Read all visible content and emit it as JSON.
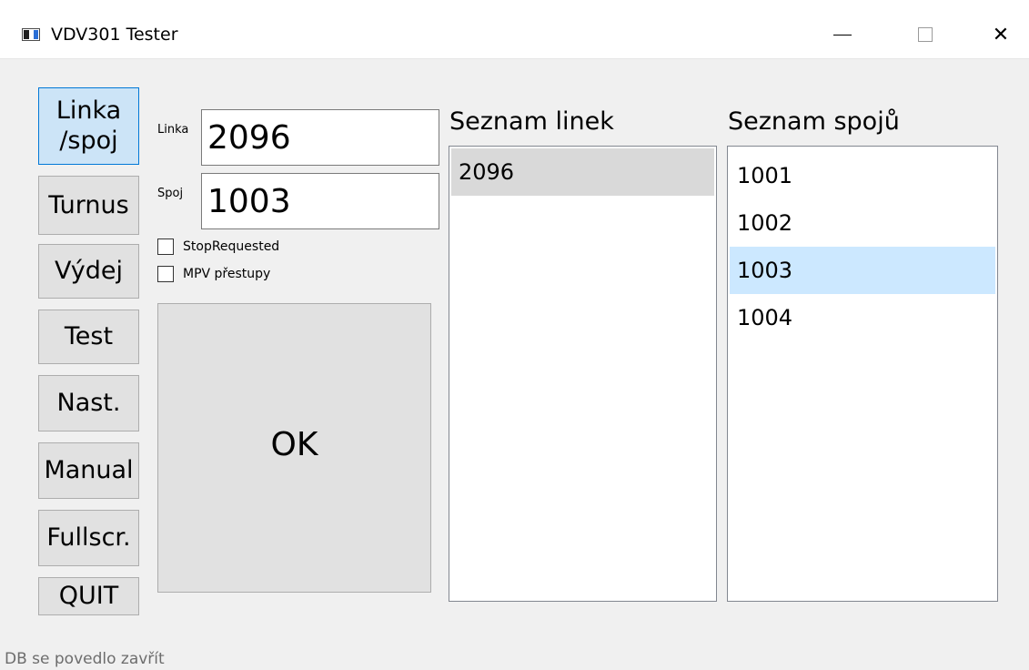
{
  "window": {
    "title": "VDV301 Tester",
    "close_glyph": "✕"
  },
  "sidebar": {
    "items": [
      {
        "label": "Linka\n/spoj"
      },
      {
        "label": "Turnus"
      },
      {
        "label": "Výdej"
      },
      {
        "label": "Test"
      },
      {
        "label": "Nast."
      },
      {
        "label": "Manual"
      },
      {
        "label": "Fullscr."
      },
      {
        "label": "QUIT"
      }
    ]
  },
  "form": {
    "linka_label": "Linka",
    "linka_value": "2096",
    "spoj_label": "Spoj",
    "spoj_value": "1003",
    "stop_requested_label": "StopRequested",
    "mpv_label": "MPV přestupy",
    "ok_label": "OK"
  },
  "lines_list": {
    "title": "Seznam linek",
    "items": [
      "2096"
    ]
  },
  "trips_list": {
    "title": "Seznam spojů",
    "items": [
      "1001",
      "1002",
      "1003",
      "1004"
    ]
  },
  "status": {
    "text": "DB se povedlo zavřít"
  },
  "colors": {
    "active_accent": "#0078d7",
    "selected_item": "#cce8ff"
  }
}
